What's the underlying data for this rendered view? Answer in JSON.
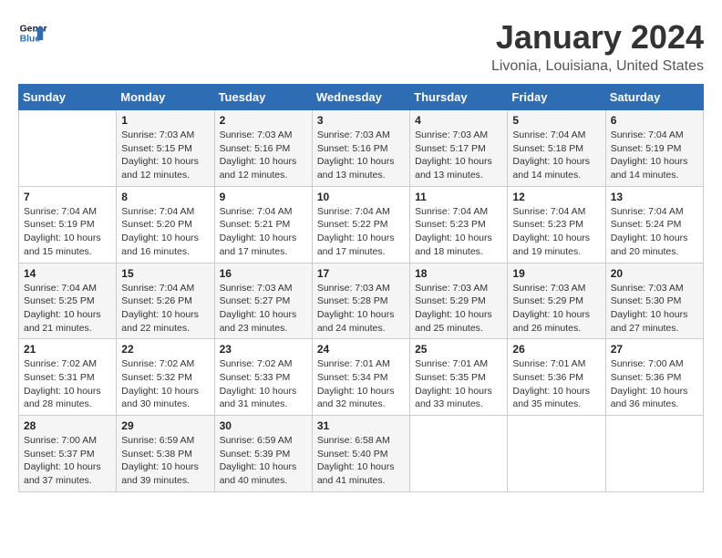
{
  "logo": {
    "name_part1": "General",
    "name_part2": "Blue"
  },
  "title": "January 2024",
  "subtitle": "Livonia, Louisiana, United States",
  "headers": [
    "Sunday",
    "Monday",
    "Tuesday",
    "Wednesday",
    "Thursday",
    "Friday",
    "Saturday"
  ],
  "weeks": [
    [
      {
        "day": "",
        "sunrise": "",
        "sunset": "",
        "daylight": ""
      },
      {
        "day": "1",
        "sunrise": "Sunrise: 7:03 AM",
        "sunset": "Sunset: 5:15 PM",
        "daylight": "Daylight: 10 hours and 12 minutes."
      },
      {
        "day": "2",
        "sunrise": "Sunrise: 7:03 AM",
        "sunset": "Sunset: 5:16 PM",
        "daylight": "Daylight: 10 hours and 12 minutes."
      },
      {
        "day": "3",
        "sunrise": "Sunrise: 7:03 AM",
        "sunset": "Sunset: 5:16 PM",
        "daylight": "Daylight: 10 hours and 13 minutes."
      },
      {
        "day": "4",
        "sunrise": "Sunrise: 7:03 AM",
        "sunset": "Sunset: 5:17 PM",
        "daylight": "Daylight: 10 hours and 13 minutes."
      },
      {
        "day": "5",
        "sunrise": "Sunrise: 7:04 AM",
        "sunset": "Sunset: 5:18 PM",
        "daylight": "Daylight: 10 hours and 14 minutes."
      },
      {
        "day": "6",
        "sunrise": "Sunrise: 7:04 AM",
        "sunset": "Sunset: 5:19 PM",
        "daylight": "Daylight: 10 hours and 14 minutes."
      }
    ],
    [
      {
        "day": "7",
        "sunrise": "Sunrise: 7:04 AM",
        "sunset": "Sunset: 5:19 PM",
        "daylight": "Daylight: 10 hours and 15 minutes."
      },
      {
        "day": "8",
        "sunrise": "Sunrise: 7:04 AM",
        "sunset": "Sunset: 5:20 PM",
        "daylight": "Daylight: 10 hours and 16 minutes."
      },
      {
        "day": "9",
        "sunrise": "Sunrise: 7:04 AM",
        "sunset": "Sunset: 5:21 PM",
        "daylight": "Daylight: 10 hours and 17 minutes."
      },
      {
        "day": "10",
        "sunrise": "Sunrise: 7:04 AM",
        "sunset": "Sunset: 5:22 PM",
        "daylight": "Daylight: 10 hours and 17 minutes."
      },
      {
        "day": "11",
        "sunrise": "Sunrise: 7:04 AM",
        "sunset": "Sunset: 5:23 PM",
        "daylight": "Daylight: 10 hours and 18 minutes."
      },
      {
        "day": "12",
        "sunrise": "Sunrise: 7:04 AM",
        "sunset": "Sunset: 5:23 PM",
        "daylight": "Daylight: 10 hours and 19 minutes."
      },
      {
        "day": "13",
        "sunrise": "Sunrise: 7:04 AM",
        "sunset": "Sunset: 5:24 PM",
        "daylight": "Daylight: 10 hours and 20 minutes."
      }
    ],
    [
      {
        "day": "14",
        "sunrise": "Sunrise: 7:04 AM",
        "sunset": "Sunset: 5:25 PM",
        "daylight": "Daylight: 10 hours and 21 minutes."
      },
      {
        "day": "15",
        "sunrise": "Sunrise: 7:04 AM",
        "sunset": "Sunset: 5:26 PM",
        "daylight": "Daylight: 10 hours and 22 minutes."
      },
      {
        "day": "16",
        "sunrise": "Sunrise: 7:03 AM",
        "sunset": "Sunset: 5:27 PM",
        "daylight": "Daylight: 10 hours and 23 minutes."
      },
      {
        "day": "17",
        "sunrise": "Sunrise: 7:03 AM",
        "sunset": "Sunset: 5:28 PM",
        "daylight": "Daylight: 10 hours and 24 minutes."
      },
      {
        "day": "18",
        "sunrise": "Sunrise: 7:03 AM",
        "sunset": "Sunset: 5:29 PM",
        "daylight": "Daylight: 10 hours and 25 minutes."
      },
      {
        "day": "19",
        "sunrise": "Sunrise: 7:03 AM",
        "sunset": "Sunset: 5:29 PM",
        "daylight": "Daylight: 10 hours and 26 minutes."
      },
      {
        "day": "20",
        "sunrise": "Sunrise: 7:03 AM",
        "sunset": "Sunset: 5:30 PM",
        "daylight": "Daylight: 10 hours and 27 minutes."
      }
    ],
    [
      {
        "day": "21",
        "sunrise": "Sunrise: 7:02 AM",
        "sunset": "Sunset: 5:31 PM",
        "daylight": "Daylight: 10 hours and 28 minutes."
      },
      {
        "day": "22",
        "sunrise": "Sunrise: 7:02 AM",
        "sunset": "Sunset: 5:32 PM",
        "daylight": "Daylight: 10 hours and 30 minutes."
      },
      {
        "day": "23",
        "sunrise": "Sunrise: 7:02 AM",
        "sunset": "Sunset: 5:33 PM",
        "daylight": "Daylight: 10 hours and 31 minutes."
      },
      {
        "day": "24",
        "sunrise": "Sunrise: 7:01 AM",
        "sunset": "Sunset: 5:34 PM",
        "daylight": "Daylight: 10 hours and 32 minutes."
      },
      {
        "day": "25",
        "sunrise": "Sunrise: 7:01 AM",
        "sunset": "Sunset: 5:35 PM",
        "daylight": "Daylight: 10 hours and 33 minutes."
      },
      {
        "day": "26",
        "sunrise": "Sunrise: 7:01 AM",
        "sunset": "Sunset: 5:36 PM",
        "daylight": "Daylight: 10 hours and 35 minutes."
      },
      {
        "day": "27",
        "sunrise": "Sunrise: 7:00 AM",
        "sunset": "Sunset: 5:36 PM",
        "daylight": "Daylight: 10 hours and 36 minutes."
      }
    ],
    [
      {
        "day": "28",
        "sunrise": "Sunrise: 7:00 AM",
        "sunset": "Sunset: 5:37 PM",
        "daylight": "Daylight: 10 hours and 37 minutes."
      },
      {
        "day": "29",
        "sunrise": "Sunrise: 6:59 AM",
        "sunset": "Sunset: 5:38 PM",
        "daylight": "Daylight: 10 hours and 39 minutes."
      },
      {
        "day": "30",
        "sunrise": "Sunrise: 6:59 AM",
        "sunset": "Sunset: 5:39 PM",
        "daylight": "Daylight: 10 hours and 40 minutes."
      },
      {
        "day": "31",
        "sunrise": "Sunrise: 6:58 AM",
        "sunset": "Sunset: 5:40 PM",
        "daylight": "Daylight: 10 hours and 41 minutes."
      },
      {
        "day": "",
        "sunrise": "",
        "sunset": "",
        "daylight": ""
      },
      {
        "day": "",
        "sunrise": "",
        "sunset": "",
        "daylight": ""
      },
      {
        "day": "",
        "sunrise": "",
        "sunset": "",
        "daylight": ""
      }
    ]
  ]
}
